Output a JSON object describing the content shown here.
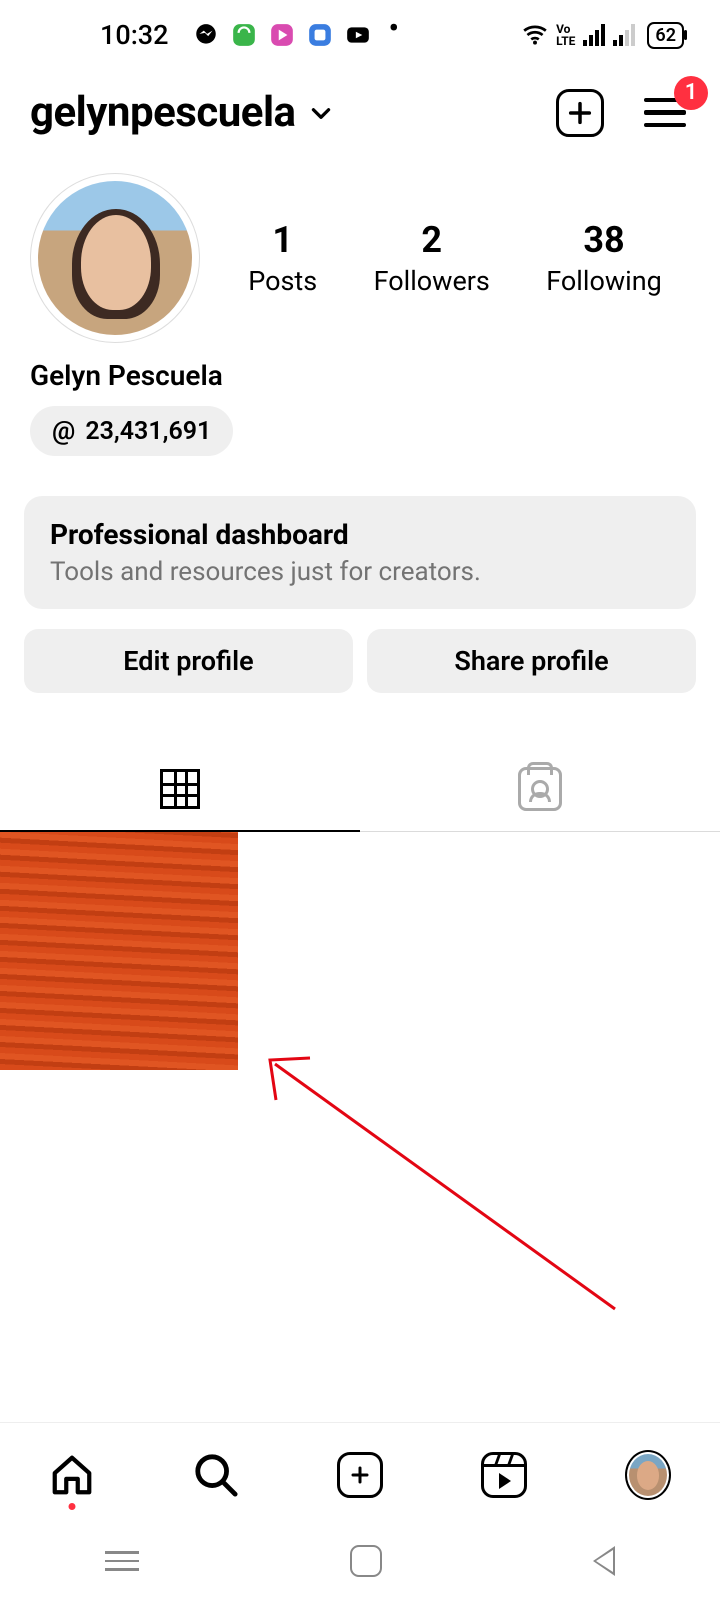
{
  "status": {
    "time": "10:32",
    "battery": "62"
  },
  "header": {
    "username": "gelynpescuela",
    "notification_count": "1"
  },
  "profile": {
    "display_name": "Gelyn Pescuela",
    "threads_count": "23,431,691",
    "stats": {
      "posts_count": "1",
      "posts_label": "Posts",
      "followers_count": "2",
      "followers_label": "Followers",
      "following_count": "38",
      "following_label": "Following"
    }
  },
  "dashboard": {
    "title": "Professional dashboard",
    "subtitle": "Tools and resources just for creators."
  },
  "actions": {
    "edit": "Edit profile",
    "share": "Share profile"
  }
}
